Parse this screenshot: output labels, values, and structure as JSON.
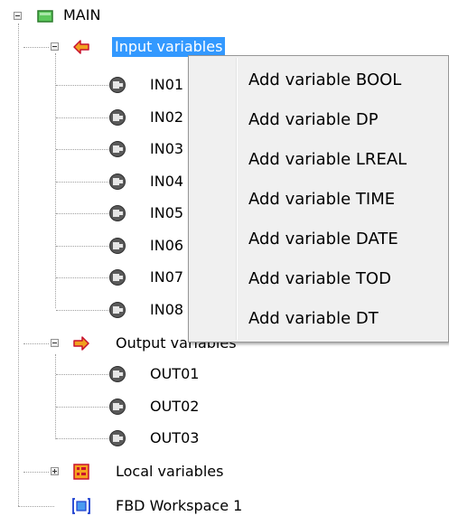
{
  "tree": {
    "root": {
      "label": "MAIN",
      "icon": "program-icon",
      "expanded": true
    },
    "input_group": {
      "label": "Input variables",
      "icon": "input-arrow-icon",
      "expanded": true,
      "selected": true
    },
    "input_items": [
      "IN01",
      "IN02",
      "IN03",
      "IN04",
      "IN05",
      "IN06",
      "IN07",
      "IN08"
    ],
    "output_group": {
      "label": "Output variables",
      "icon": "output-arrow-icon",
      "expanded": true
    },
    "output_items": [
      "OUT01",
      "OUT02",
      "OUT03"
    ],
    "local_group": {
      "label": "Local variables",
      "icon": "local-variables-icon",
      "expanded": false
    },
    "workspace": {
      "label": "FBD Workspace 1",
      "icon": "fbd-workspace-icon"
    }
  },
  "context_menu": {
    "items": [
      "Add variable BOOL",
      "Add variable DP",
      "Add variable LREAL",
      "Add variable TIME",
      "Add variable DATE",
      "Add variable TOD",
      "Add variable DT"
    ]
  },
  "colors": {
    "selection": "#3399ff",
    "input_arrow": "#f0a020",
    "output_arrow": "#f0a020",
    "program_icon": "#5cc85c",
    "variable_icon": "#5a5a5a"
  }
}
